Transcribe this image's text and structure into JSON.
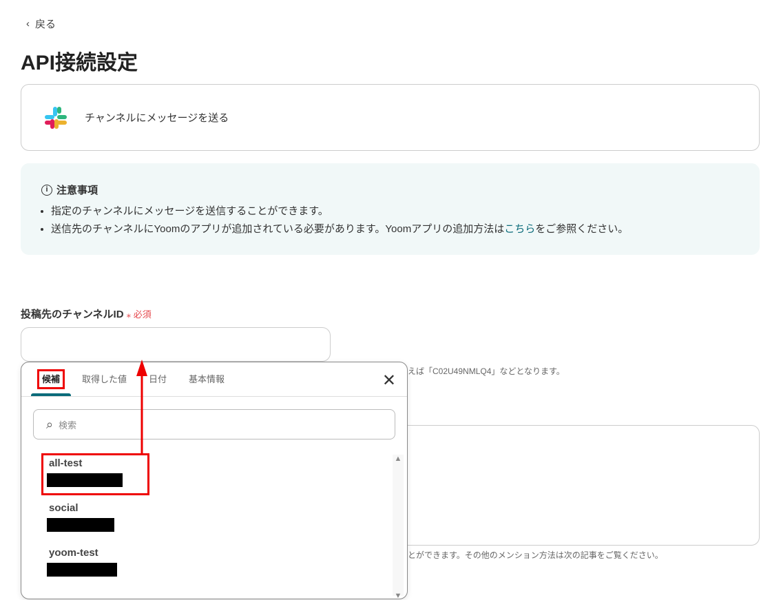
{
  "back": "戻る",
  "title": "API接続設定",
  "app": {
    "action": "チャンネルにメッセージを送る"
  },
  "notice": {
    "title": "注意事項",
    "items": [
      "指定のチャンネルにメッセージを送信することができます。"
    ],
    "item2_pre": "送信先のチャンネルにYoomのアプリが追加されている必要があります。Yoomアプリの追加方法は",
    "item2_link": "こちら",
    "item2_post": "をご参照ください。"
  },
  "field": {
    "label": "投稿先のチャンネルID",
    "required": "必須",
    "hint": "えば「C02U49NMLQ4」などとなります。"
  },
  "message_hint": "とができます。その他のメンション方法は次の記事をご覧ください。",
  "popup": {
    "tabs": [
      "候補",
      "取得した値",
      "日付",
      "基本情報"
    ],
    "search_placeholder": "検索",
    "items": [
      {
        "name": "all-test"
      },
      {
        "name": "social"
      },
      {
        "name": "yoom-test"
      }
    ]
  }
}
